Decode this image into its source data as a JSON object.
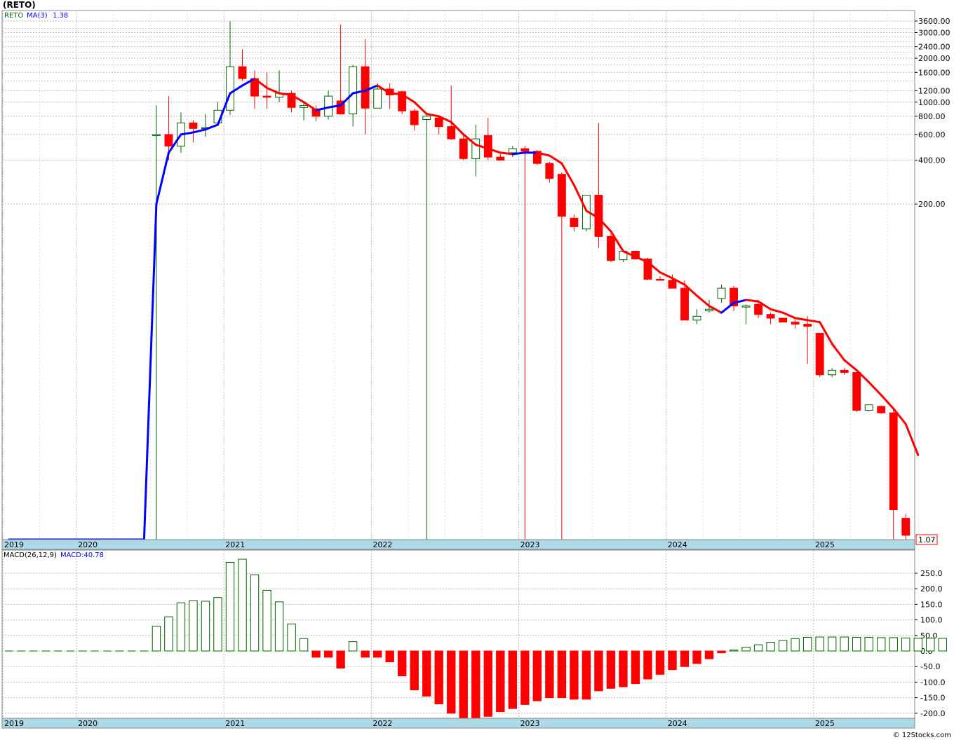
{
  "chart_title": "(RETO)",
  "credit": "© 12Stocks.com",
  "price_panel": {
    "legend": {
      "ticker": "RETO",
      "ma_label": "MA(3)",
      "ma_value": "1.38"
    },
    "last_price_label": "1.07",
    "y_ticks": [
      3600,
      3000,
      2400,
      2000,
      1600,
      1200,
      1000,
      800,
      600,
      400,
      200
    ],
    "y_tick_labels": [
      "3600.00",
      "3000.00",
      "2400.00",
      "2000.00",
      "1600.00",
      "1200.00",
      "1000.00",
      "800.00",
      "600.00",
      "400.00",
      "200.00"
    ]
  },
  "macd_panel": {
    "legend": {
      "label": "MACD(26,12,9)",
      "value_label": "MACD:40.78"
    },
    "y_ticks": [
      250,
      200,
      150,
      100,
      50,
      0,
      -50,
      -100,
      -150,
      -200
    ],
    "y_tick_labels": [
      "250.0",
      "200.0",
      "150.0",
      "100.0",
      "50.0",
      "0.0",
      "-50.0",
      "-100.0",
      "-150.0",
      "-200.0"
    ]
  },
  "x_axis_labels": [
    "2019",
    "2020",
    "2021",
    "2022",
    "2023",
    "2024",
    "2025"
  ],
  "colors": {
    "up": "#006400",
    "down": "#ff0000",
    "ma_up": "#0000ff",
    "ma_down": "#ff0000",
    "axis_band": "#add8e6"
  },
  "chart_data": [
    {
      "type": "candlestick",
      "scale": "log",
      "series_name": "RETO",
      "x": [
        "2019",
        "2020",
        "2021",
        "2022",
        "2023",
        "2024",
        "2025"
      ],
      "candles": [
        {
          "o": 1,
          "h": 1,
          "l": 1,
          "c": 1
        },
        {
          "o": 1,
          "h": 1,
          "l": 1,
          "c": 1
        },
        {
          "o": 1,
          "h": 1,
          "l": 1,
          "c": 1
        },
        {
          "o": 1,
          "h": 1,
          "l": 1,
          "c": 1
        },
        {
          "o": 1,
          "h": 1,
          "l": 1,
          "c": 1
        },
        {
          "o": 1,
          "h": 1,
          "l": 1,
          "c": 1
        },
        {
          "o": 1,
          "h": 1,
          "l": 1,
          "c": 1
        },
        {
          "o": 1,
          "h": 1,
          "l": 1,
          "c": 1
        },
        {
          "o": 1,
          "h": 1,
          "l": 1,
          "c": 1
        },
        {
          "o": 1,
          "h": 1,
          "l": 1,
          "c": 1
        },
        {
          "o": 1,
          "h": 1,
          "l": 1,
          "c": 1
        },
        {
          "o": 1,
          "h": 1,
          "l": 1,
          "c": 1
        },
        {
          "o": 600,
          "h": 950,
          "l": 1,
          "c": 600
        },
        {
          "o": 600,
          "h": 1100,
          "l": 400,
          "c": 500
        },
        {
          "o": 500,
          "h": 850,
          "l": 450,
          "c": 720
        },
        {
          "o": 720,
          "h": 750,
          "l": 530,
          "c": 660
        },
        {
          "o": 660,
          "h": 830,
          "l": 580,
          "c": 670
        },
        {
          "o": 720,
          "h": 1000,
          "l": 700,
          "c": 880
        },
        {
          "o": 880,
          "h": 3600,
          "l": 820,
          "c": 1750
        },
        {
          "o": 1750,
          "h": 2300,
          "l": 1400,
          "c": 1450
        },
        {
          "o": 1450,
          "h": 1650,
          "l": 900,
          "c": 1100
        },
        {
          "o": 1100,
          "h": 1600,
          "l": 900,
          "c": 1080
        },
        {
          "o": 1080,
          "h": 1650,
          "l": 1000,
          "c": 1150
        },
        {
          "o": 1150,
          "h": 1200,
          "l": 850,
          "c": 920
        },
        {
          "o": 920,
          "h": 1000,
          "l": 750,
          "c": 950
        },
        {
          "o": 900,
          "h": 950,
          "l": 740,
          "c": 800
        },
        {
          "o": 800,
          "h": 1200,
          "l": 760,
          "c": 1100
        },
        {
          "o": 1020,
          "h": 3400,
          "l": 820,
          "c": 830
        },
        {
          "o": 830,
          "h": 1800,
          "l": 680,
          "c": 1750
        },
        {
          "o": 1750,
          "h": 2700,
          "l": 600,
          "c": 910
        },
        {
          "o": 910,
          "h": 1350,
          "l": 910,
          "c": 1230
        },
        {
          "o": 1230,
          "h": 1350,
          "l": 900,
          "c": 1120
        },
        {
          "o": 1180,
          "h": 1200,
          "l": 830,
          "c": 870
        },
        {
          "o": 870,
          "h": 900,
          "l": 640,
          "c": 700
        },
        {
          "o": 760,
          "h": 820,
          "l": 1,
          "c": 800
        },
        {
          "o": 780,
          "h": 800,
          "l": 600,
          "c": 680
        },
        {
          "o": 680,
          "h": 1300,
          "l": 550,
          "c": 560
        },
        {
          "o": 560,
          "h": 590,
          "l": 400,
          "c": 410
        },
        {
          "o": 410,
          "h": 700,
          "l": 310,
          "c": 560
        },
        {
          "o": 590,
          "h": 780,
          "l": 400,
          "c": 420
        },
        {
          "o": 420,
          "h": 440,
          "l": 400,
          "c": 400
        },
        {
          "o": 450,
          "h": 500,
          "l": 420,
          "c": 480
        },
        {
          "o": 480,
          "h": 500,
          "l": 1,
          "c": 460
        },
        {
          "o": 460,
          "h": 470,
          "l": 370,
          "c": 380
        },
        {
          "o": 380,
          "h": 390,
          "l": 280,
          "c": 300
        },
        {
          "o": 320,
          "h": 330,
          "l": 1,
          "c": 165
        },
        {
          "o": 160,
          "h": 170,
          "l": 130,
          "c": 140
        },
        {
          "o": 135,
          "h": 230,
          "l": 130,
          "c": 230
        },
        {
          "o": 230,
          "h": 720,
          "l": 100,
          "c": 120
        },
        {
          "o": 120,
          "h": 125,
          "l": 80,
          "c": 82
        },
        {
          "o": 83,
          "h": 98,
          "l": 80,
          "c": 95
        },
        {
          "o": 95,
          "h": 96,
          "l": 83,
          "c": 84
        },
        {
          "o": 84,
          "h": 86,
          "l": 60,
          "c": 61
        },
        {
          "o": 61,
          "h": 64,
          "l": 60,
          "c": 60
        },
        {
          "o": 60,
          "h": 66,
          "l": 53,
          "c": 53
        },
        {
          "o": 53,
          "h": 60,
          "l": 32,
          "c": 32
        },
        {
          "o": 32,
          "h": 38,
          "l": 30,
          "c": 34
        },
        {
          "o": 37,
          "h": 44,
          "l": 36,
          "c": 38
        },
        {
          "o": 45,
          "h": 56,
          "l": 42,
          "c": 53
        },
        {
          "o": 53,
          "h": 55,
          "l": 37,
          "c": 40
        },
        {
          "o": 40,
          "h": 41,
          "l": 30,
          "c": 40
        },
        {
          "o": 41,
          "h": 44,
          "l": 33,
          "c": 35
        },
        {
          "o": 35,
          "h": 36,
          "l": 30,
          "c": 33
        },
        {
          "o": 33,
          "h": 33,
          "l": 31,
          "c": 31
        },
        {
          "o": 31,
          "h": 32,
          "l": 28,
          "c": 30
        },
        {
          "o": 30,
          "h": 34,
          "l": 16,
          "c": 29
        },
        {
          "o": 26,
          "h": 26,
          "l": 13,
          "c": 13.5
        },
        {
          "o": 13.5,
          "h": 15,
          "l": 13,
          "c": 14.5
        },
        {
          "o": 14.5,
          "h": 15,
          "l": 13.5,
          "c": 14
        },
        {
          "o": 14,
          "h": 14,
          "l": 7.5,
          "c": 7.7
        },
        {
          "o": 7.7,
          "h": 8.4,
          "l": 7.6,
          "c": 8.4
        },
        {
          "o": 8.2,
          "h": 8.3,
          "l": 7.3,
          "c": 7.4
        },
        {
          "o": 7.4,
          "h": 8,
          "l": 1,
          "c": 1.6
        },
        {
          "o": 1.4,
          "h": 1.5,
          "l": 1,
          "c": 1.07
        }
      ],
      "ma3": [
        1,
        1,
        1,
        1,
        1,
        1,
        1,
        1,
        1,
        1,
        1,
        1,
        200,
        450,
        600,
        620,
        650,
        700,
        1150,
        1300,
        1450,
        1250,
        1150,
        1120,
        1000,
        880,
        920,
        950,
        1150,
        1200,
        1300,
        1150,
        1130,
        1000,
        830,
        800,
        730,
        600,
        510,
        480,
        450,
        440,
        450,
        450,
        430,
        380,
        270,
        180,
        160,
        130,
        95,
        87,
        80,
        68,
        62,
        56,
        47,
        40,
        36,
        42,
        44,
        43,
        38,
        36,
        33,
        32,
        31,
        22,
        17,
        14.5,
        12,
        9.8,
        7.9,
        6.2,
        3.8
      ],
      "ma3_color_by_index_from": 36
    },
    {
      "type": "bar",
      "series_name": "MACD histogram",
      "values": [
        0,
        0,
        0,
        0,
        0,
        0,
        0,
        0,
        0,
        0,
        0,
        0,
        80,
        110,
        155,
        162,
        160,
        172,
        285,
        295,
        245,
        195,
        158,
        87,
        40,
        -20,
        -20,
        -55,
        30,
        -20,
        -20,
        -35,
        -80,
        -125,
        -145,
        -170,
        -200,
        -215,
        -215,
        -210,
        -195,
        -185,
        -172,
        -160,
        -150,
        -150,
        -155,
        -155,
        -128,
        -120,
        -115,
        -105,
        -90,
        -75,
        -60,
        -50,
        -40,
        -25,
        -6,
        3,
        12,
        20,
        28,
        34,
        40,
        44,
        45,
        45,
        45,
        44,
        44,
        43,
        43,
        42,
        41,
        41,
        40.78
      ]
    }
  ]
}
